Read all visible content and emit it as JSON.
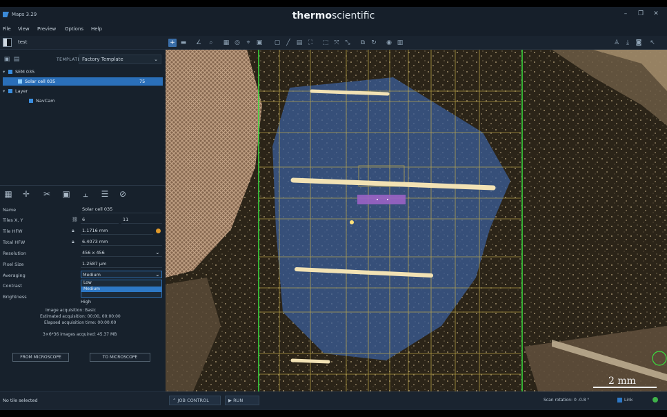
{
  "app": {
    "title": "Maps 3.29",
    "brand_bold": "thermo",
    "brand_light": "scientific"
  },
  "menu": [
    "File",
    "View",
    "Preview",
    "Options",
    "Help"
  ],
  "panel": {
    "toggle_text": "test",
    "template_label": "TEMPLATE",
    "template_value": "Factory Template"
  },
  "tree": [
    {
      "label": "SEM 035",
      "level": 0,
      "expanded": true
    },
    {
      "label": "Solar cell 035",
      "level": 1,
      "selected": true,
      "badge": "75"
    },
    {
      "label": "Layer",
      "level": 0,
      "expanded": true
    },
    {
      "label": "NavCam",
      "level": 1
    }
  ],
  "properties": {
    "name_label": "Name",
    "name_value": "Solar cell 035",
    "tiles_label": "Tiles X, Y",
    "tiles_x": "6",
    "tiles_y": "11",
    "tile_hfw_label": "Tile HFW",
    "tile_hfw_value": "1.1716 mm",
    "total_hfw_label": "Total HFW",
    "total_hfw_value": "6.4073 mm",
    "resolution_label": "Resolution",
    "resolution_value": "456 x 456",
    "pixel_size_label": "Pixel Size",
    "pixel_size_value": "1.2587 µm",
    "averaging_label": "Averaging",
    "averaging_value": "Medium",
    "contrast_label": "Contrast",
    "brightness_label": "Brightness",
    "options": [
      "Low",
      "Medium",
      "High"
    ]
  },
  "info": {
    "line1": "Image acquisition: Basic",
    "line2": "Estimated acquisition: 00:00, 00:00:00",
    "line3": "Elapsed acquisition time: 00:00:00",
    "line4": "3×6*36 images acquired: 45.37 MB"
  },
  "buttons": {
    "from_microscope": "FROM MICROSCOPE",
    "to_microscope": "TO MICROSCOPE"
  },
  "status": {
    "selection": "No tile selected",
    "job_control": "JOB CONTROL",
    "run": "RUN",
    "scan_rotation": "Scan rotation:  0  -0.8  °",
    "link": "Link"
  },
  "viewport": {
    "scale_label": "2 mm"
  }
}
